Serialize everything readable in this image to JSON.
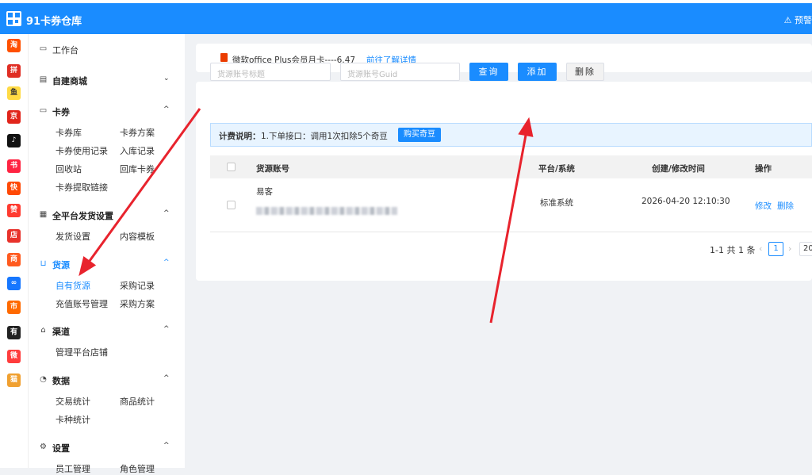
{
  "app": {
    "title": "91卡券仓库",
    "alert_label": "预警"
  },
  "rail_icons": [
    {
      "name": "taobao-icon",
      "glyph": "淘",
      "color": "#ff5000"
    },
    {
      "name": "pinduoduo-icon",
      "glyph": "拼",
      "color": "#e02e24"
    },
    {
      "name": "xianyu-icon",
      "glyph": "鱼",
      "color": "#ffda44"
    },
    {
      "name": "jd-icon",
      "glyph": "京",
      "color": "#e1251b"
    },
    {
      "name": "douyin-icon",
      "glyph": "♪",
      "color": "#111111"
    },
    {
      "name": "xiaohongshu-icon",
      "glyph": "书",
      "color": "#ff2442"
    },
    {
      "name": "kuaishou-icon",
      "glyph": "快",
      "color": "#ff4906"
    },
    {
      "name": "thumb-icon",
      "glyph": "赞",
      "color": "#ff3b30"
    },
    {
      "name": "shop-icon",
      "glyph": "店",
      "color": "#e8322b"
    },
    {
      "name": "store-icon",
      "glyph": "商",
      "color": "#ff5a1f"
    },
    {
      "name": "link-icon",
      "glyph": "∞",
      "color": "#1677ff"
    },
    {
      "name": "market-icon",
      "glyph": "市",
      "color": "#ff6a00"
    },
    {
      "name": "youzan-icon",
      "glyph": "有",
      "color": "#222222"
    },
    {
      "name": "weidian-icon",
      "glyph": "微",
      "color": "#ff3d3d"
    },
    {
      "name": "mascot-icon",
      "glyph": "猫",
      "color": "#f0a030"
    }
  ],
  "sidebar": {
    "workbench": "工作台",
    "self_mall": "自建商城",
    "coupons": "卡券",
    "coupon_items": [
      "卡券库",
      "卡券方案",
      "卡券使用记录",
      "入库记录",
      "回收站",
      "回库卡券",
      "卡券提取链接"
    ],
    "delivery": "全平台发货设置",
    "delivery_items": [
      "发货设置",
      "内容模板"
    ],
    "supply": "货源",
    "supply_items": [
      "自有货源",
      "采购记录",
      "充值账号管理",
      "采购方案"
    ],
    "channel": "渠道",
    "channel_items": [
      "管理平台店铺"
    ],
    "stats": "数据",
    "stats_items": [
      "交易统计",
      "商品统计",
      "卡种统计"
    ],
    "settings": "设置",
    "settings_items": [
      "员工管理",
      "角色管理"
    ]
  },
  "notice": {
    "text": "微软office Plus会员月卡----6.47",
    "link": "前往了解详情"
  },
  "search": {
    "title_placeholder": "货源账号标题",
    "guid_placeholder": "货源账号Guid"
  },
  "buttons": {
    "query": "查询",
    "add": "添加",
    "delete": "删除",
    "buy": "购买奇豆"
  },
  "billing": {
    "label": "计费说明：",
    "text": "1.下单接口：调用1次扣除5个奇豆"
  },
  "table": {
    "columns": [
      "货源账号",
      "平台/系统",
      "创建/修改时间",
      "操作"
    ],
    "rows": [
      {
        "name": "易客",
        "platform": "标准系统",
        "time": "2026-04-20 12:10:30",
        "edit": "修改",
        "remove": "删除"
      }
    ]
  },
  "pagination": {
    "summary": "1-1 共 1 条",
    "current": "1",
    "page_size": "20"
  },
  "colors": {
    "accent": "#1a8cff",
    "arrow": "#e8232d"
  }
}
